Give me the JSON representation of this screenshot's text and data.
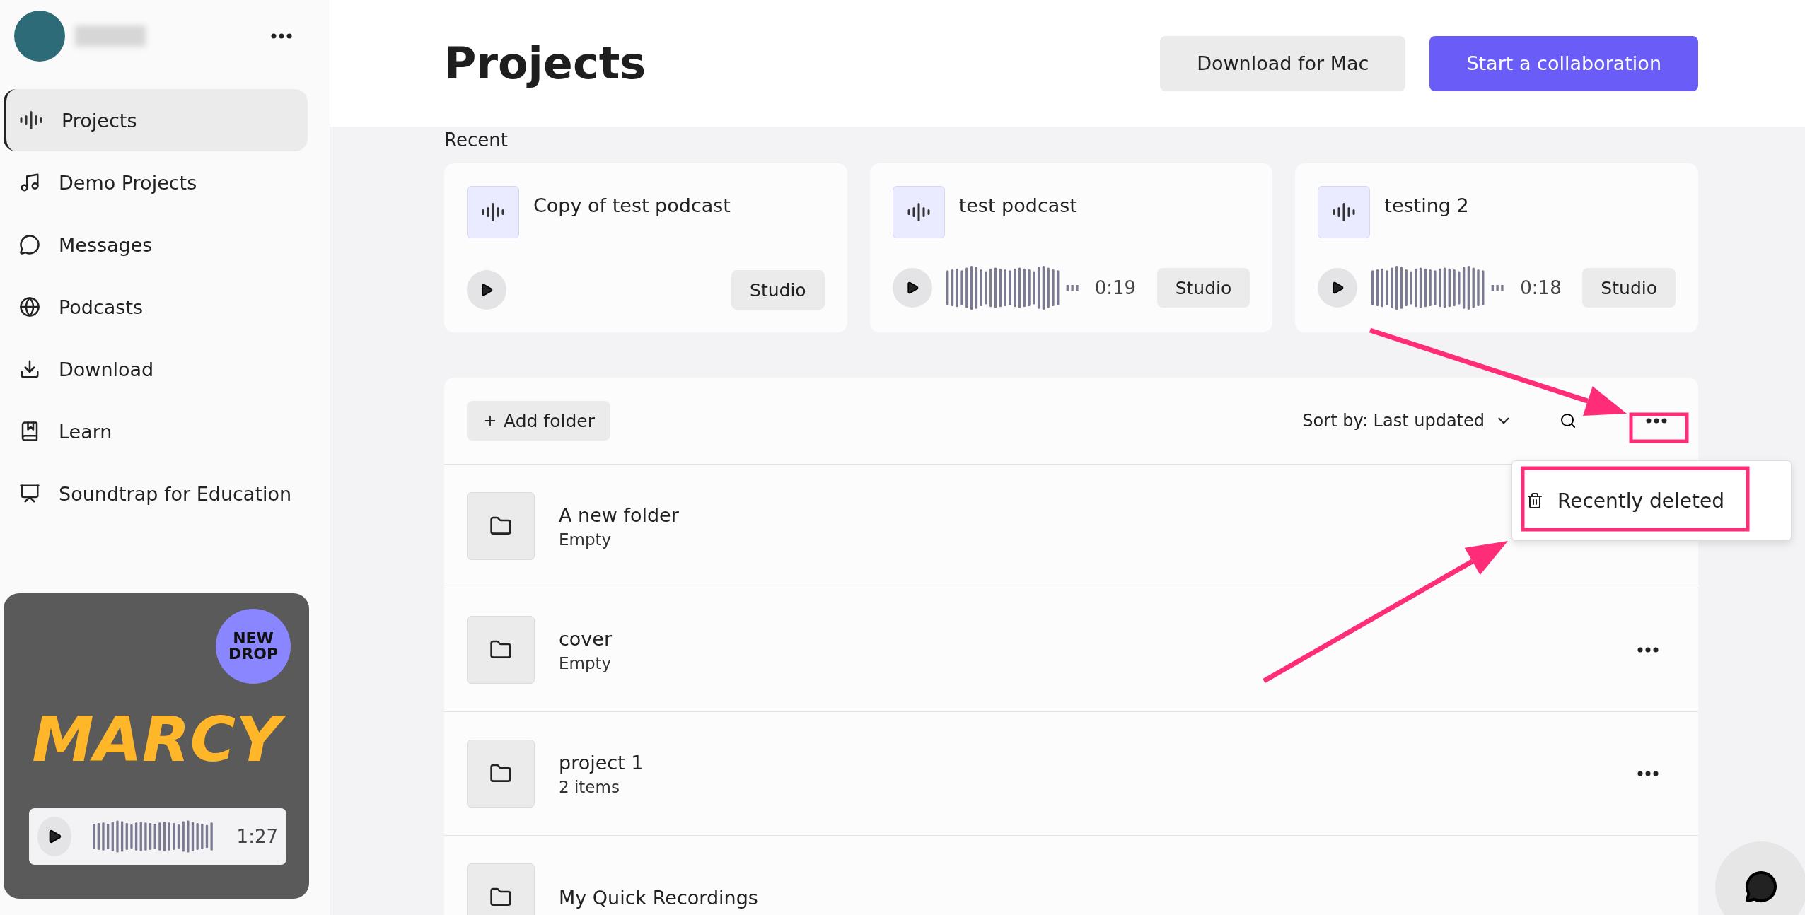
{
  "sidebar": {
    "items": [
      {
        "label": "Projects",
        "selected": true
      },
      {
        "label": "Demo Projects",
        "selected": false
      },
      {
        "label": "Messages",
        "selected": false
      },
      {
        "label": "Podcasts",
        "selected": false
      },
      {
        "label": "Download",
        "selected": false
      },
      {
        "label": "Learn",
        "selected": false
      },
      {
        "label": "Soundtrap for Education",
        "selected": false
      }
    ],
    "promo": {
      "badge": "NEW DROP",
      "title": "MARCY",
      "duration": "1:27"
    }
  },
  "header": {
    "title": "Projects",
    "buttons": [
      {
        "label": "Download for Mac",
        "kind": "secondary"
      },
      {
        "label": "Start a collaboration",
        "kind": "primary"
      }
    ]
  },
  "recent": {
    "heading": "Recent",
    "cards": [
      {
        "title": "Copy of test podcast",
        "waveform": false,
        "button": "Studio"
      },
      {
        "title": "test podcast",
        "waveform": true,
        "duration": "0:19",
        "button": "Studio"
      },
      {
        "title": "testing 2",
        "waveform": true,
        "duration": "0:18",
        "button": "Studio"
      }
    ]
  },
  "folders": {
    "add_button": "Add folder",
    "sort_label": "Sort by: Last updated",
    "menu": {
      "items": [
        {
          "label": "Recently deleted"
        }
      ]
    },
    "rows": [
      {
        "name": "A new folder",
        "detail": "Empty"
      },
      {
        "name": "cover",
        "detail": "Empty"
      },
      {
        "name": "project 1",
        "detail": "2 items"
      },
      {
        "name": "My Quick Recordings"
      }
    ]
  }
}
